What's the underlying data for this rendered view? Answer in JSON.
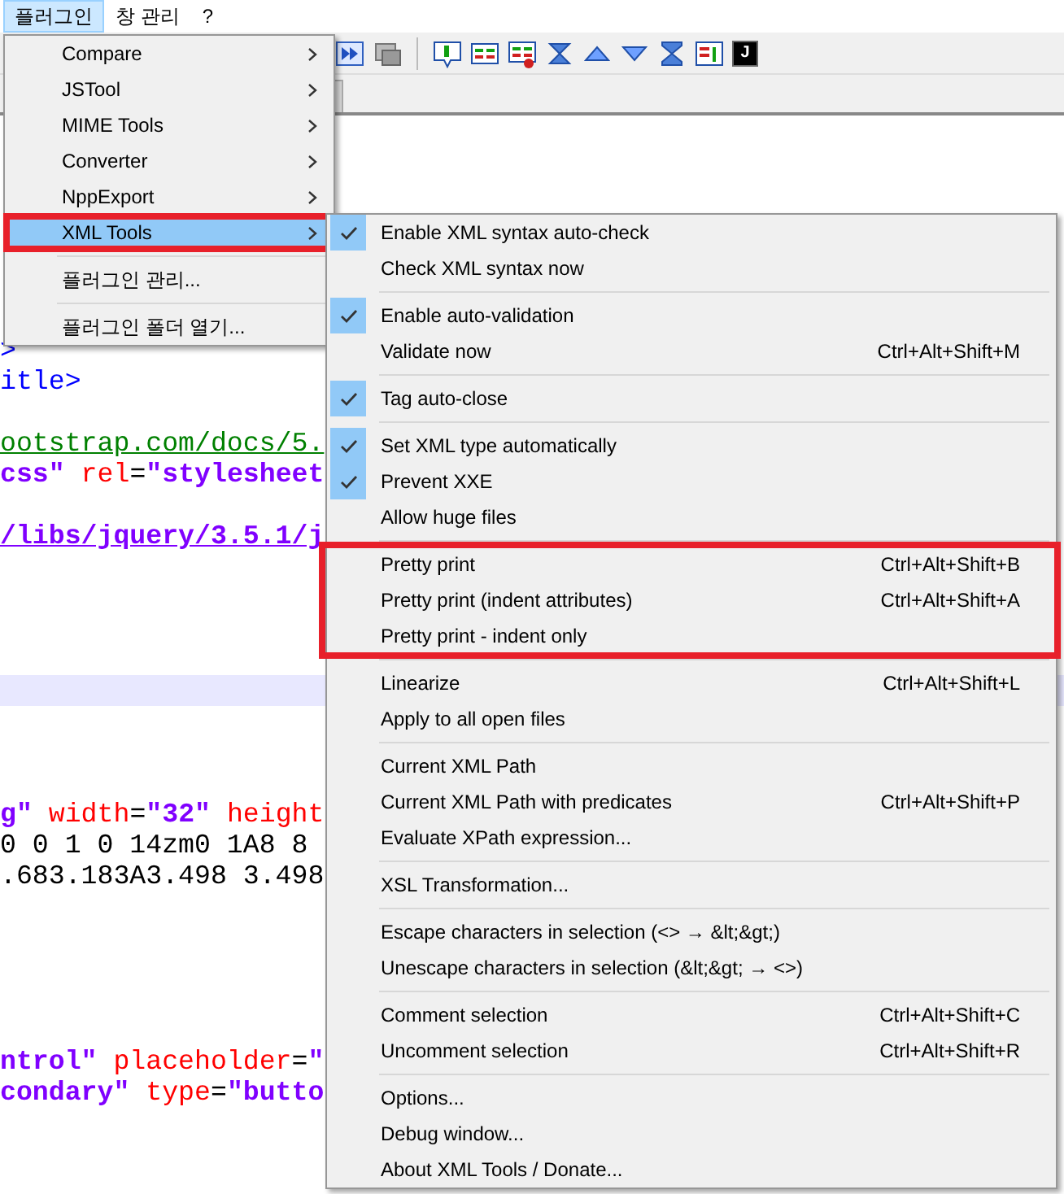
{
  "menubar": [
    {
      "label": "플러그인",
      "selected": true
    },
    {
      "label": "창 관리",
      "selected": false
    },
    {
      "label": "?",
      "selected": false
    }
  ],
  "toolbar": {
    "console_label": "J"
  },
  "editor": {
    "lines": [
      {
        "kind": "code",
        "segments": [
          {
            "kind": "tag",
            "text": ">"
          }
        ]
      },
      {
        "kind": "code",
        "segments": [
          {
            "kind": "tag",
            "text": "itle>"
          }
        ]
      },
      {
        "kind": "blank"
      },
      {
        "kind": "code",
        "segments": [
          {
            "kind": "url",
            "text": "ootstrap.com/docs/5."
          }
        ]
      },
      {
        "kind": "code",
        "segments": [
          {
            "kind": "value",
            "text": "css\""
          },
          {
            "kind": "attr",
            "text": " rel"
          },
          {
            "kind": "plain",
            "text": "="
          },
          {
            "kind": "value",
            "text": "\"stylesheet"
          }
        ]
      },
      {
        "kind": "blank"
      },
      {
        "kind": "code",
        "segments": [
          {
            "kind": "link",
            "text": "/libs/jquery/3.5.1/j"
          }
        ]
      },
      {
        "kind": "blank"
      },
      {
        "kind": "blank"
      },
      {
        "kind": "blank"
      },
      {
        "kind": "blank"
      },
      {
        "kind": "current"
      },
      {
        "kind": "blank"
      },
      {
        "kind": "blank"
      },
      {
        "kind": "blank"
      },
      {
        "kind": "code",
        "segments": [
          {
            "kind": "link",
            "text": "g"
          },
          {
            "kind": "value",
            "text": "\""
          },
          {
            "kind": "attr",
            "text": " width"
          },
          {
            "kind": "plain",
            "text": "="
          },
          {
            "kind": "value",
            "text": "\"32\""
          },
          {
            "kind": "attr",
            "text": " height"
          }
        ]
      },
      {
        "kind": "code",
        "segments": [
          {
            "kind": "plain",
            "text": "0 0 1 0 14zm0 1A8 8"
          }
        ]
      },
      {
        "kind": "code",
        "segments": [
          {
            "kind": "plain",
            "text": ".683.183A3.498 3.498"
          }
        ]
      },
      {
        "kind": "blank"
      },
      {
        "kind": "blank"
      },
      {
        "kind": "blank"
      },
      {
        "kind": "blank"
      },
      {
        "kind": "blank"
      },
      {
        "kind": "code",
        "segments": [
          {
            "kind": "value",
            "text": "ntrol\""
          },
          {
            "kind": "attr",
            "text": " placeholder"
          },
          {
            "kind": "plain",
            "text": "="
          },
          {
            "kind": "value",
            "text": "\""
          }
        ]
      },
      {
        "kind": "code",
        "segments": [
          {
            "kind": "value",
            "text": "condary\""
          },
          {
            "kind": "attr",
            "text": " type"
          },
          {
            "kind": "plain",
            "text": "="
          },
          {
            "kind": "value",
            "text": "\"butto"
          }
        ]
      }
    ]
  },
  "plugin_menu": {
    "groups": [
      {
        "items": [
          {
            "label": "Compare",
            "submenu": true,
            "selected": false,
            "annotated": false
          },
          {
            "label": "JSTool",
            "submenu": true,
            "selected": false,
            "annotated": false
          },
          {
            "label": "MIME Tools",
            "submenu": true,
            "selected": false,
            "annotated": false
          },
          {
            "label": "Converter",
            "submenu": true,
            "selected": false,
            "annotated": false
          },
          {
            "label": "NppExport",
            "submenu": true,
            "selected": false,
            "annotated": false
          },
          {
            "label": "XML Tools",
            "submenu": true,
            "selected": true,
            "annotated": true
          }
        ]
      },
      {
        "items": [
          {
            "label": "플러그인 관리...",
            "submenu": false,
            "selected": false,
            "annotated": false
          }
        ]
      },
      {
        "items": [
          {
            "label": "플러그인 폴더 열기...",
            "submenu": false,
            "selected": false,
            "annotated": false
          }
        ]
      }
    ]
  },
  "xml_tools_menu": {
    "groups": [
      {
        "annotated": false,
        "items": [
          {
            "label": "Enable XML syntax auto-check",
            "checked": true
          },
          {
            "label": "Check XML syntax now",
            "checked": false
          }
        ]
      },
      {
        "annotated": false,
        "items": [
          {
            "label": "Enable auto-validation",
            "checked": true
          },
          {
            "label": "Validate now",
            "checked": false,
            "shortcut": "Ctrl+Alt+Shift+M"
          }
        ]
      },
      {
        "annotated": false,
        "items": [
          {
            "label": "Tag auto-close",
            "checked": true
          }
        ]
      },
      {
        "annotated": false,
        "items": [
          {
            "label": "Set XML type automatically",
            "checked": true
          },
          {
            "label": "Prevent XXE",
            "checked": true
          },
          {
            "label": "Allow huge files",
            "checked": false
          }
        ]
      },
      {
        "annotated": true,
        "items": [
          {
            "label": "Pretty print",
            "checked": false,
            "shortcut": "Ctrl+Alt+Shift+B"
          },
          {
            "label": "Pretty print (indent attributes)",
            "checked": false,
            "shortcut": "Ctrl+Alt+Shift+A"
          },
          {
            "label": "Pretty print - indent only",
            "checked": false
          }
        ]
      },
      {
        "annotated": false,
        "items": [
          {
            "label": "Linearize",
            "checked": false,
            "shortcut": "Ctrl+Alt+Shift+L"
          },
          {
            "label": "Apply to all open files",
            "checked": false
          }
        ]
      },
      {
        "annotated": false,
        "items": [
          {
            "label": "Current XML Path",
            "checked": false
          },
          {
            "label": "Current XML Path with predicates",
            "checked": false,
            "shortcut": "Ctrl+Alt+Shift+P"
          },
          {
            "label": "Evaluate XPath expression...",
            "checked": false
          }
        ]
      },
      {
        "annotated": false,
        "items": [
          {
            "label": "XSL Transformation...",
            "checked": false
          }
        ]
      },
      {
        "annotated": false,
        "items": [
          {
            "label": "Escape characters in selection (<> → &lt;&gt;)",
            "checked": false
          },
          {
            "label": "Unescape characters in selection (&lt;&gt; → <>)",
            "checked": false
          }
        ]
      },
      {
        "annotated": false,
        "items": [
          {
            "label": "Comment selection",
            "checked": false,
            "shortcut": "Ctrl+Alt+Shift+C"
          },
          {
            "label": "Uncomment selection",
            "checked": false,
            "shortcut": "Ctrl+Alt+Shift+R"
          }
        ]
      },
      {
        "annotated": false,
        "items": [
          {
            "label": "Options...",
            "checked": false
          },
          {
            "label": "Debug window...",
            "checked": false
          },
          {
            "label": "About XML Tools / Donate...",
            "checked": false
          }
        ]
      }
    ]
  }
}
